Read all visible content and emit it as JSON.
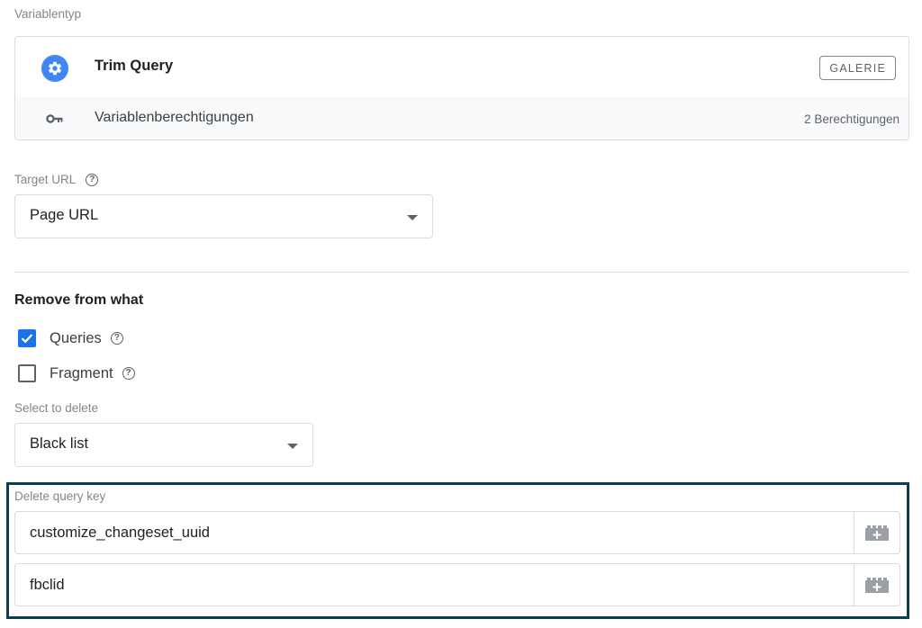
{
  "variable_type": {
    "label": "Variablentyp",
    "template_name": "Trim Query",
    "template_icon": "gear-icon",
    "gallery_button": "GALERIE",
    "permissions_icon": "key-icon",
    "permissions_label": "Variablenberechtigungen",
    "permissions_count": "2 Berechtigungen",
    "accent_color": "#4285f4"
  },
  "target_url": {
    "label": "Target URL",
    "help": "?",
    "selected": "Page URL"
  },
  "remove_from": {
    "title": "Remove from what",
    "options": [
      {
        "label": "Queries",
        "checked": true,
        "help": "?"
      },
      {
        "label": "Fragment",
        "checked": false,
        "help": "?"
      }
    ]
  },
  "select_to_delete": {
    "label": "Select to delete",
    "selected": "Black list"
  },
  "delete_query_key": {
    "label": "Delete query key",
    "rows": [
      {
        "value": "customize_changeset_uuid",
        "button_icon": "variable-picker-icon"
      },
      {
        "value": "fbclid",
        "button_icon": "variable-picker-icon"
      }
    ],
    "highlight_color": "#0d3c55"
  }
}
